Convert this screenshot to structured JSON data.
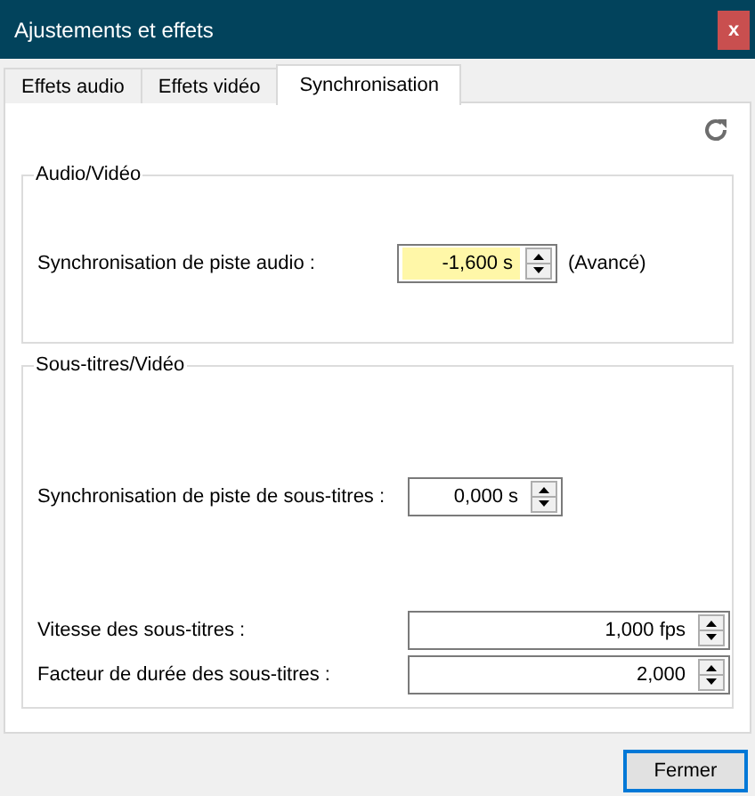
{
  "window": {
    "title": "Ajustements et effets",
    "close_label": "x"
  },
  "tabs": [
    {
      "label": "Effets audio",
      "selected": false
    },
    {
      "label": "Effets vidéo",
      "selected": false
    },
    {
      "label": "Synchronisation",
      "selected": true
    }
  ],
  "groups": [
    {
      "title": "Audio/Vidéo",
      "rows": [
        {
          "kind": "offset",
          "label": "Synchronisation de piste audio :",
          "value": "-1,600 s",
          "highlighted": true,
          "note": "(Avancé)"
        }
      ]
    },
    {
      "title": "Sous-titres/Vidéo",
      "rows": [
        {
          "kind": "offset",
          "label": "Synchronisation de piste de sous-titres :",
          "value": "0,000 s",
          "highlighted": false
        },
        {
          "kind": "rate",
          "label": "Vitesse des sous-titres :",
          "value": "1,000 fps",
          "highlighted": false
        },
        {
          "kind": "rate",
          "label": "Facteur de durée des sous-titres :",
          "value": "2,000",
          "highlighted": false
        }
      ]
    }
  ],
  "buttons": [
    "Fermer"
  ]
}
